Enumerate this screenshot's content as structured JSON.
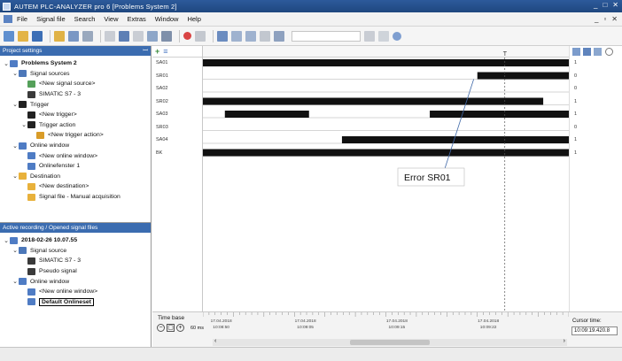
{
  "window": {
    "title": "AUTEM PLC-ANALYZER pro 6 [Problems System 2]",
    "controls": [
      "_",
      "□",
      "✕"
    ]
  },
  "menu": {
    "items": [
      "File",
      "Signal file",
      "Search",
      "View",
      "Extras",
      "Window",
      "Help"
    ],
    "mdi_controls": [
      "_",
      "▫",
      "✕"
    ]
  },
  "project_settings": {
    "header": "Project settings",
    "pin": "ꟷ",
    "tree": [
      {
        "label": "Problems System 2",
        "depth": 0,
        "expanded": true,
        "bold": true,
        "icon": "project-icon",
        "color": "#4f7cc4"
      },
      {
        "label": "Signal sources",
        "depth": 1,
        "expanded": true,
        "icon": "signal-source-icon",
        "color": "#4d78b9"
      },
      {
        "label": "<New signal source>",
        "depth": 2,
        "icon": "new-signal-source-icon",
        "color": "#55a05a"
      },
      {
        "label": "SIMATIC S7 - 3",
        "depth": 2,
        "icon": "plc-icon",
        "color": "#3a3a3a"
      },
      {
        "label": "Trigger",
        "depth": 1,
        "expanded": true,
        "icon": "trigger-icon",
        "color": "#222222"
      },
      {
        "label": "<New trigger>",
        "depth": 2,
        "icon": "trigger-icon",
        "color": "#222222"
      },
      {
        "label": "Trigger action",
        "depth": 2,
        "expanded": true,
        "icon": "trigger-action-icon",
        "color": "#222222"
      },
      {
        "label": "<New trigger action>",
        "depth": 3,
        "icon": "new-trigger-action-icon",
        "color": "#d99c28"
      },
      {
        "label": "Online window",
        "depth": 1,
        "expanded": true,
        "icon": "online-window-icon",
        "color": "#4f7cc4"
      },
      {
        "label": "<New online window>",
        "depth": 2,
        "icon": "online-window-icon",
        "color": "#4f7cc4"
      },
      {
        "label": "Onlinefenster 1",
        "depth": 2,
        "icon": "online-window-icon",
        "color": "#4f7cc4"
      },
      {
        "label": "Destination",
        "depth": 1,
        "expanded": true,
        "icon": "destination-icon",
        "color": "#e8b13b"
      },
      {
        "label": "<New destination>",
        "depth": 2,
        "icon": "new-destination-icon",
        "color": "#e8b13b"
      },
      {
        "label": "Signal file - Manual acquisition",
        "depth": 2,
        "icon": "signal-file-icon",
        "color": "#e8b13b"
      }
    ]
  },
  "active_recording": {
    "header": "Active recording / Opened signal files",
    "tree": [
      {
        "label": "2018-02-26 10.07.55",
        "depth": 0,
        "expanded": true,
        "bold": true,
        "icon": "recording-icon",
        "color": "#4f7cc4"
      },
      {
        "label": "Signal source",
        "depth": 1,
        "expanded": true,
        "icon": "signal-source-icon",
        "color": "#4d78b9"
      },
      {
        "label": "SIMATIC S7 - 3",
        "depth": 2,
        "icon": "plc-icon",
        "color": "#3a3a3a"
      },
      {
        "label": "Pseudo signal",
        "depth": 2,
        "icon": "pseudo-signal-icon",
        "color": "#3a3a3a"
      },
      {
        "label": "Online window",
        "depth": 1,
        "expanded": true,
        "icon": "online-window-icon",
        "color": "#4f7cc4"
      },
      {
        "label": "<New online window>",
        "depth": 2,
        "icon": "online-window-icon",
        "color": "#4f7cc4"
      },
      {
        "label": "Default Onlineset",
        "depth": 2,
        "icon": "online-window-icon",
        "color": "#4f7cc4",
        "boxed": true
      }
    ]
  },
  "channels": [
    {
      "name": "SA01",
      "segments": [
        [
          0,
          1
        ]
      ],
      "value": "1"
    },
    {
      "name": "SR01",
      "segments": [
        [
          0.75,
          1
        ]
      ],
      "value": "0"
    },
    {
      "name": "SA02",
      "segments": [],
      "value": "0"
    },
    {
      "name": "SR02",
      "segments": [
        [
          0,
          0.93
        ]
      ],
      "value": "1"
    },
    {
      "name": "SA03",
      "segments": [
        [
          0.06,
          0.29
        ],
        [
          0.62,
          1
        ]
      ],
      "value": "1"
    },
    {
      "name": "SR03",
      "segments": [],
      "value": "0"
    },
    {
      "name": "SA04",
      "segments": [
        [
          0.38,
          1
        ]
      ],
      "value": "1"
    },
    {
      "name": "BK",
      "segments": [
        [
          0,
          1
        ]
      ],
      "value": "1"
    }
  ],
  "cursor": {
    "position": 0.825,
    "marker": "T"
  },
  "annotation": {
    "text": "Error SR01"
  },
  "timeline": {
    "time_base_label": "Time base",
    "time_base_value": "60 ms",
    "ticks": [
      {
        "pos": 0.05,
        "date": "17.04.2018",
        "time": "10:08:50"
      },
      {
        "pos": 0.28,
        "date": "17.04.2018",
        "time": "10:09:05"
      },
      {
        "pos": 0.53,
        "date": "17.04.2018",
        "time": "10:09:15"
      },
      {
        "pos": 0.78,
        "date": "17.04.2018",
        "time": "10:09:22"
      }
    ],
    "cursor_time_label": "Cursor time:",
    "cursor_time_value": "10:09:19.420.8",
    "scroll_left": "‹",
    "scroll_right": "›",
    "zoom_out": "−",
    "zoom_fit": "▢",
    "zoom_in": "+"
  },
  "icons": {
    "add_channel": "+",
    "channel_list": "≡"
  }
}
